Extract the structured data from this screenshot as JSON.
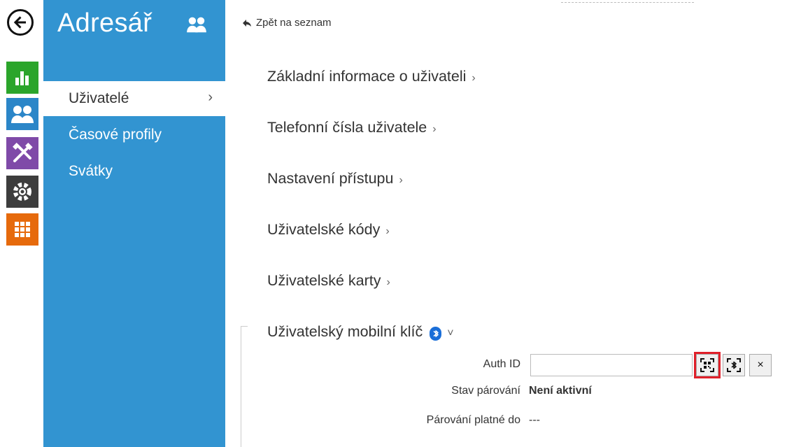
{
  "sidebar": {
    "title": "Adresář",
    "items": [
      {
        "label": "Uživatelé",
        "chevron": "›"
      },
      {
        "label": "Časové profily"
      },
      {
        "label": "Svátky"
      }
    ]
  },
  "rail_icons": [
    "back-arrow-icon",
    "status-chart-icon",
    "directory-users-icon",
    "hardware-tools-icon",
    "services-gear-icon",
    "system-grid-icon"
  ],
  "main": {
    "back_link": "Zpět na seznam",
    "sections": [
      {
        "label": "Základní informace o uživateli",
        "chevron": "›"
      },
      {
        "label": "Telefonní čísla uživatele",
        "chevron": "›"
      },
      {
        "label": "Nastavení přístupu",
        "chevron": "›"
      },
      {
        "label": "Uživatelské kódy",
        "chevron": "›"
      },
      {
        "label": "Uživatelské karty",
        "chevron": "›"
      },
      {
        "label": "Uživatelský mobilní klíč",
        "chevron": "˅"
      }
    ],
    "mobile_key": {
      "auth_id_label": "Auth ID",
      "auth_id_value": "",
      "pairing_state_label": "Stav párování",
      "pairing_state_value": "Není aktivní",
      "pairing_valid_label": "Párování platné do",
      "pairing_valid_value": "---",
      "clear_button": "×"
    }
  },
  "colors": {
    "sidebar": "#3294d1",
    "status": "#2ba52b",
    "directory": "#2b86c8",
    "hardware": "#7f4aa8",
    "services": "#3d3d3d",
    "system": "#e66a0c",
    "highlight": "#e0202a"
  }
}
